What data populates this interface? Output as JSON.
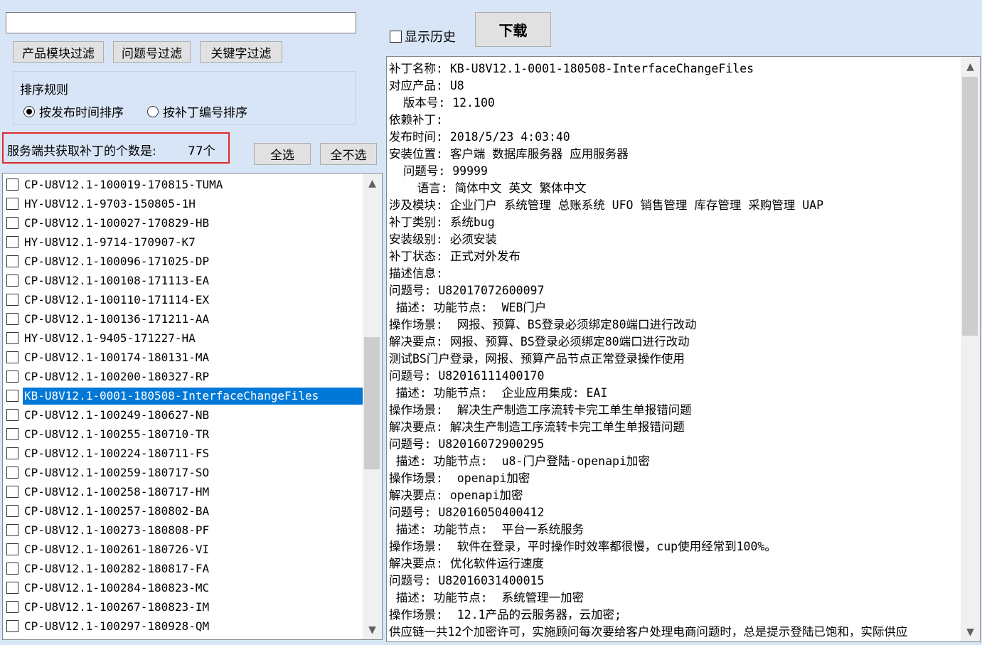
{
  "filter": {
    "search_value": "",
    "module_filter_label": "产品模块过滤",
    "issue_filter_label": "问题号过滤",
    "keyword_filter_label": "关键字过滤"
  },
  "sort": {
    "title": "排序规则",
    "by_time_label": "按发布时间排序",
    "by_number_label": "按补丁编号排序",
    "selected": "by_time"
  },
  "count": {
    "label": "服务端共获取补丁的个数是:",
    "value": "77个"
  },
  "select_all_label": "全选",
  "select_none_label": "全不选",
  "show_history_label": "显示历史",
  "download_label": "下载",
  "patch_list": {
    "selected_index": 11,
    "items": [
      "CP-U8V12.1-100019-170815-TUMA",
      "HY-U8V12.1-9703-150805-1H",
      "CP-U8V12.1-100027-170829-HB",
      "HY-U8V12.1-9714-170907-K7",
      "CP-U8V12.1-100096-171025-DP",
      "CP-U8V12.1-100108-171113-EA",
      "CP-U8V12.1-100110-171114-EX",
      "CP-U8V12.1-100136-171211-AA",
      "HY-U8V12.1-9405-171227-HA",
      "CP-U8V12.1-100174-180131-MA",
      "CP-U8V12.1-100200-180327-RP",
      "KB-U8V12.1-0001-180508-InterfaceChangeFiles",
      "CP-U8V12.1-100249-180627-NB",
      "CP-U8V12.1-100255-180710-TR",
      "CP-U8V12.1-100224-180711-FS",
      "CP-U8V12.1-100259-180717-SO",
      "CP-U8V12.1-100258-180717-HM",
      "CP-U8V12.1-100257-180802-BA",
      "CP-U8V12.1-100273-180808-PF",
      "CP-U8V12.1-100261-180726-VI",
      "CP-U8V12.1-100282-180817-FA",
      "CP-U8V12.1-100284-180823-MC",
      "CP-U8V12.1-100267-180823-IM",
      "CP-U8V12.1-100297-180928-QM"
    ]
  },
  "detail_lines": [
    "补丁名称: KB-U8V12.1-0001-180508-InterfaceChangeFiles",
    "对应产品: U8",
    "  版本号: 12.100",
    "依赖补丁:",
    "发布时间: 2018/5/23 4:03:40",
    "安装位置: 客户端 数据库服务器 应用服务器",
    "  问题号: 99999",
    "    语言: 简体中文 英文 繁体中文",
    "涉及模块: 企业门户 系统管理 总账系统 UFO 销售管理 库存管理 采购管理 UAP",
    "补丁类别: 系统bug",
    "安装级别: 必须安装",
    "补丁状态: 正式对外发布",
    "描述信息:",
    "问题号: U82017072600097",
    " 描述: 功能节点:  WEB门户",
    "操作场景:  网报、预算、BS登录必须绑定80端口进行改动",
    "解决要点: 网报、预算、BS登录必须绑定80端口进行改动",
    "测试BS门户登录，网报、预算产品节点正常登录操作使用",
    "问题号: U82016111400170",
    " 描述: 功能节点:  企业应用集成: EAI",
    "操作场景:  解决生产制造工序流转卡完工单生单报错问题",
    "解决要点: 解决生产制造工序流转卡完工单生单报错问题",
    "问题号: U82016072900295",
    " 描述: 功能节点:  u8-门户登陆-openapi加密",
    "操作场景:  openapi加密",
    "解决要点: openapi加密",
    "问题号: U82016050400412",
    " 描述: 功能节点:  平台一系统服务",
    "操作场景:  软件在登录，平时操作时效率都很慢，cup使用经常到100%。",
    "解决要点: 优化软件运行速度",
    "问题号: U82016031400015",
    " 描述: 功能节点:  系统管理一加密",
    "操作场景:  12.1产品的云服务器，云加密;",
    "供应链一共12个加密许可，实施顾问每次要给客户处理电商问题时，总是提示登陆已饱和，实际供应"
  ],
  "icons": {
    "scroll_up": "scroll-up-arrow-icon",
    "scroll_down": "scroll-down-arrow-icon"
  },
  "colors": {
    "window_bg": "#d8e5f7",
    "selection": "#0078d7",
    "highlight_border": "#e02b2b"
  }
}
